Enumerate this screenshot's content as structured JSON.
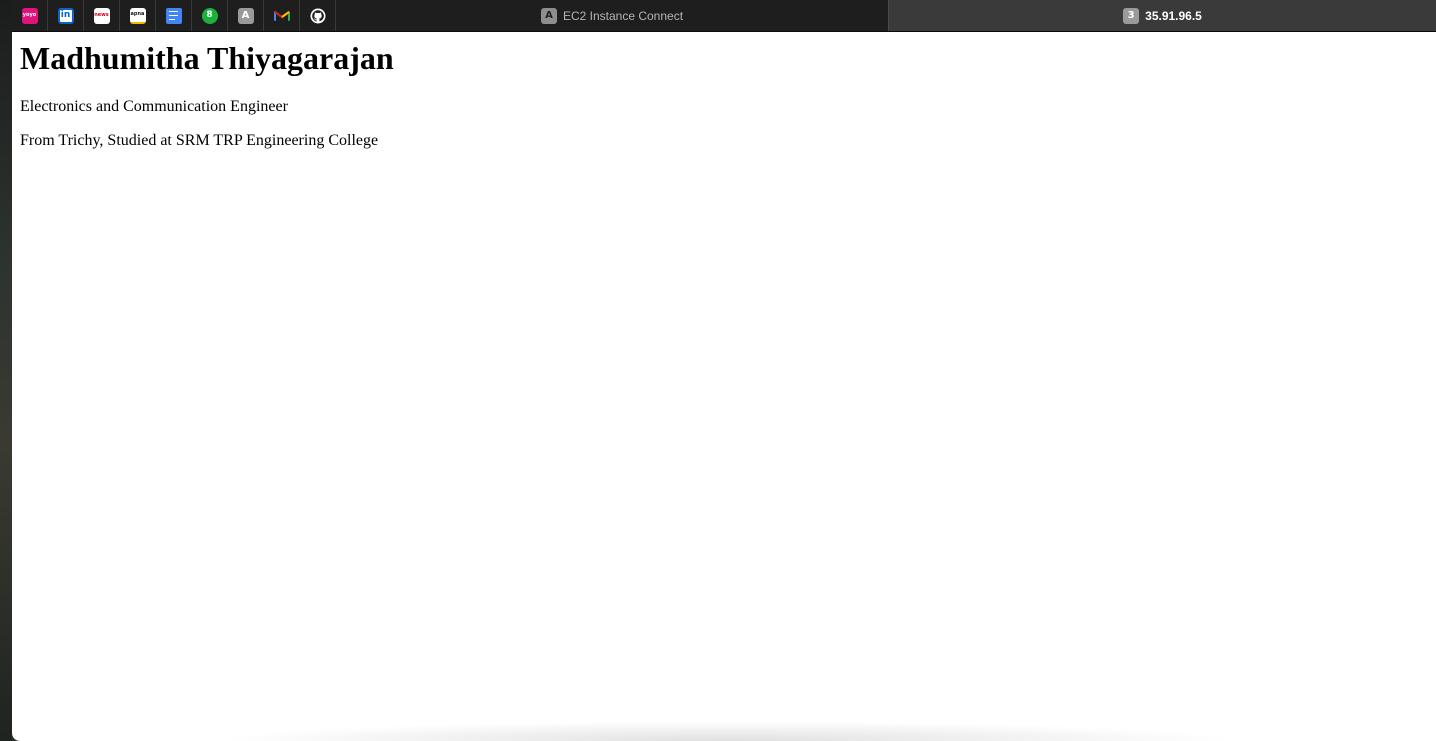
{
  "pinned_tabs": [
    {
      "name": "yoyo-icon",
      "glyph": "yoyo"
    },
    {
      "name": "linkedin-icon",
      "glyph": "in"
    },
    {
      "name": "news-icon",
      "glyph": "news"
    },
    {
      "name": "apna-icon",
      "glyph": "apna"
    },
    {
      "name": "google-docs-icon",
      "glyph": ""
    },
    {
      "name": "green-circle-icon",
      "glyph": "8"
    },
    {
      "name": "letter-a-icon",
      "glyph": "A"
    },
    {
      "name": "gmail-icon",
      "glyph": ""
    },
    {
      "name": "github-icon",
      "glyph": ""
    }
  ],
  "tabs": [
    {
      "icon_letter": "A",
      "title": "EC2 Instance Connect",
      "active": false
    },
    {
      "icon_letter": "3",
      "title": "35.91.96.5",
      "active": true
    }
  ],
  "page": {
    "heading": "Madhumitha Thiyagarajan",
    "paragraphs": [
      "Electronics and Communication Engineer",
      "From Trichy, Studied at SRM TRP Engineering College"
    ]
  },
  "colors": {
    "tabbar_bg": "#1e1e1e",
    "active_tab_bg": "#3a3a3a",
    "linkedin_blue": "#0a66c2",
    "docs_blue": "#4285f4",
    "green": "#19b33c"
  }
}
